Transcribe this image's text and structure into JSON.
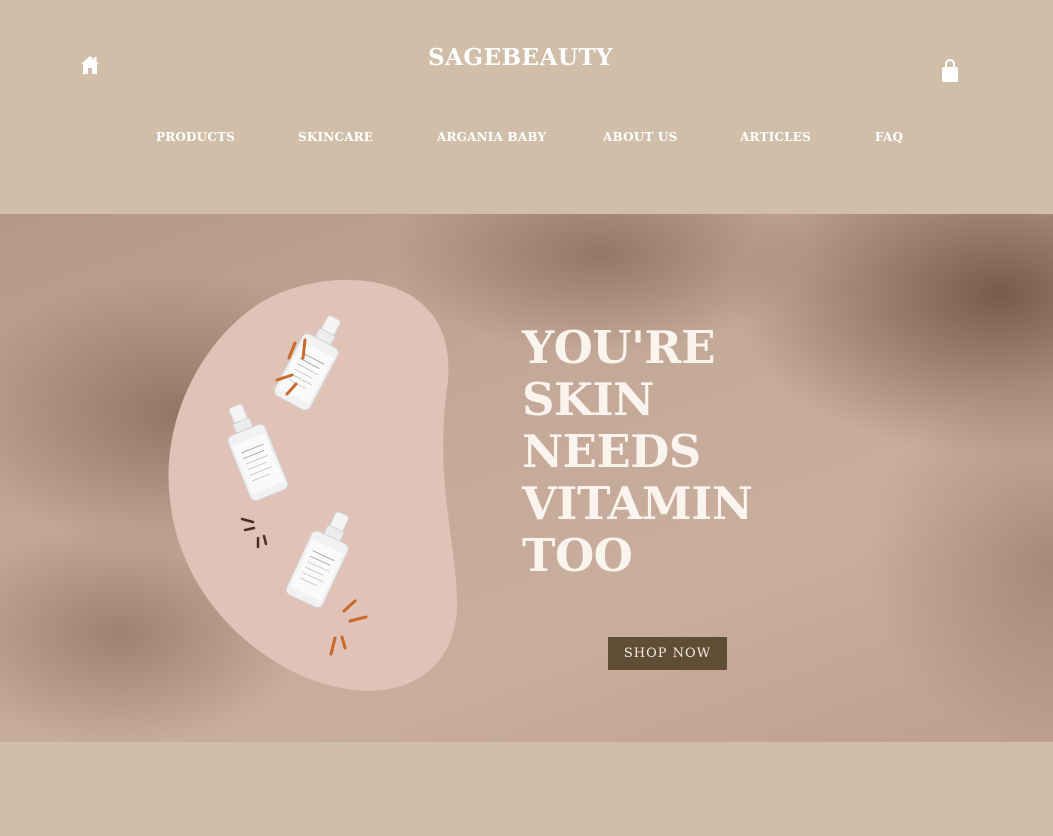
{
  "header": {
    "brand": "SAGEBEAUTY",
    "home_icon": "home-icon",
    "cart_icon": "shopping-bag-icon"
  },
  "nav": {
    "items": [
      {
        "label": "PRODUCTS"
      },
      {
        "label": "SKINCARE"
      },
      {
        "label": "ARGANIA BABY"
      },
      {
        "label": "ABOUT US"
      },
      {
        "label": "ARTICLES"
      },
      {
        "label": "FAQ"
      }
    ]
  },
  "hero": {
    "headline_lines": [
      "YOU'RE",
      "SKIN",
      "NEEDS",
      "VITAMIN",
      "TOO"
    ],
    "cta_label": "SHOP NOW"
  },
  "colors": {
    "background": "#d1bea8",
    "blob": "#e0c3b6",
    "cta": "#5f4d36",
    "headline": "#fbf3ee",
    "accent_orange": "#c96a2a",
    "accent_dark": "#4a2e22"
  }
}
